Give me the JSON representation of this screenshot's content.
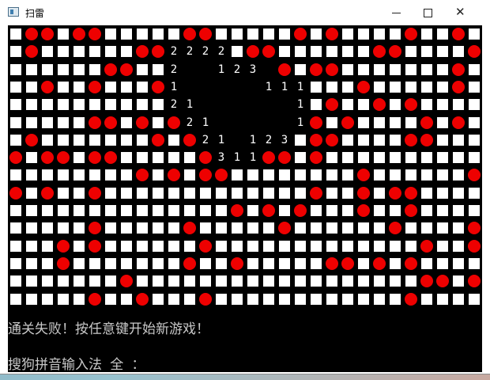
{
  "window": {
    "title": "扫雷"
  },
  "board": {
    "rows": [
      "HMMHMMHHHHHMMHHHHHMHMHHHHMHHMH",
      "HMHHHHHHMM2222HMMHHHHHHMMHHHHM",
      "HHHHHHMMHH2  123 MHMMHHHHHHHMH",
      "HHMHHMHHHM1     111HHHMHHHHHMH",
      "HHHHHHHHHH21      1HMHHMHMHHHH",
      "HHHHHMMHMHM21     1MHMHHHHMHMH",
      "HMHHHHHHHMHM21 123HMMHHHHMMHHH",
      "MHMMHMMHHHHHM311MMHMHHHHHHHHHH",
      "HHHHHHHHMHMHMMHHHHHHHHMHHHHHHM",
      "MHMHHMHHHHHHHHHHHHHMHHMHMMHHHH",
      "HHHHHHHHHHHHHHMHMHMHHHMHHMHHHH",
      "HHHHHMHHHHHMHHHHHMHHHHHHMHHHHM",
      "HHHMHMHHHHHHMHHHHHHHHHHHHHMHHM",
      "HHHMHHHHHHHMHHMHHHHHMMHMHMHHHH",
      "HHHHHHHMHHHHHHHHHHHHHHHHHHMMHM",
      "HHHHHMHHMHHHMHHHHHHHHHHHHMHHHH"
    ],
    "colors": {
      "mine": "#ee0000",
      "hidden": "#ffffff",
      "background": "#000000",
      "number": "#ffffff"
    }
  },
  "status": {
    "message": "通关失败！按任意键开始新游戏！",
    "ime": "搜狗拼音输入法 全 ："
  }
}
